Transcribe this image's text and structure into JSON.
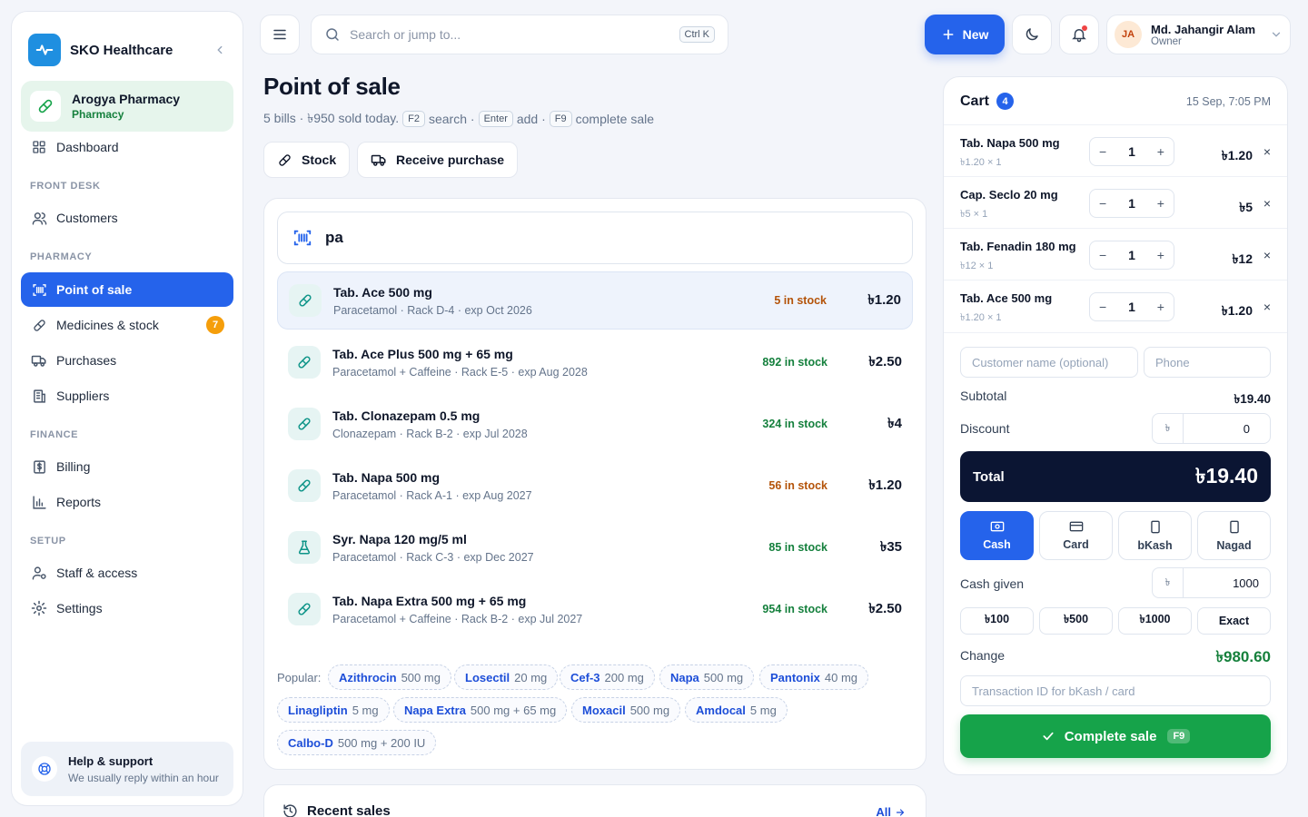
{
  "brand": {
    "name": "SKO Healthcare"
  },
  "org": {
    "name": "Arogya Pharmacy",
    "type": "Pharmacy"
  },
  "nav": {
    "dashboard": "Dashboard",
    "front_desk": "FRONT DESK",
    "customers": "Customers",
    "pharmacy": "PHARMACY",
    "pos": "Point of sale",
    "medicines": "Medicines & stock",
    "medicines_badge": "7",
    "purchases": "Purchases",
    "suppliers": "Suppliers",
    "finance": "FINANCE",
    "billing": "Billing",
    "reports": "Reports",
    "setup": "SETUP",
    "staff": "Staff & access",
    "settings": "Settings"
  },
  "help": {
    "title": "Help & support",
    "subtitle": "We usually reply within an hour"
  },
  "topbar": {
    "search_placeholder": "Search or jump to...",
    "search_shortcut": "Ctrl K",
    "new_label": "New",
    "user_initials": "JA",
    "user_name": "Md. Jahangir Alam",
    "user_role": "Owner"
  },
  "page": {
    "title": "Point of sale",
    "summary": "5 bills · ৳950 sold today.",
    "kbd_search": "F2",
    "search_word": "search ·",
    "kbd_add": "Enter",
    "add_word": "add ·",
    "kbd_complete": "F9",
    "complete_word": "complete sale",
    "stock_btn": "Stock",
    "receive_btn": "Receive purchase"
  },
  "product_search": {
    "value": "pa"
  },
  "products": [
    {
      "name": "Tab. Ace 500 mg",
      "details": "Paracetamol · Rack D-4 · exp Oct 2026",
      "stock": "5 in stock",
      "price": "৳1.20"
    },
    {
      "name": "Tab. Ace Plus 500 mg + 65 mg",
      "details": "Paracetamol + Caffeine · Rack E-5 · exp Aug 2028",
      "stock": "892 in stock",
      "price": "৳2.50"
    },
    {
      "name": "Tab. Clonazepam 0.5 mg",
      "details": "Clonazepam · Rack B-2 · exp Jul 2028",
      "stock": "324 in stock",
      "price": "৳4"
    },
    {
      "name": "Tab. Napa 500 mg",
      "details": "Paracetamol · Rack A-1 · exp Aug 2027",
      "stock": "56 in stock",
      "price": "৳1.20"
    },
    {
      "name": "Syr. Napa 120 mg/5 ml",
      "details": "Paracetamol · Rack C-3 · exp Dec 2027",
      "stock": "85 in stock",
      "price": "৳35"
    },
    {
      "name": "Tab. Napa Extra 500 mg + 65 mg",
      "details": "Paracetamol + Caffeine · Rack B-2 · exp Jul 2027",
      "stock": "954 in stock",
      "price": "৳2.50"
    }
  ],
  "popular": {
    "label": "Popular:",
    "items": [
      {
        "name": "Azithrocin",
        "dose": "500 mg"
      },
      {
        "name": "Losectil",
        "dose": "20 mg"
      },
      {
        "name": "Cef-3",
        "dose": "200 mg"
      },
      {
        "name": "Napa",
        "dose": "500 mg"
      },
      {
        "name": "Pantonix",
        "dose": "40 mg"
      },
      {
        "name": "Linagliptin",
        "dose": "5 mg"
      },
      {
        "name": "Napa Extra",
        "dose": "500 mg + 65 mg"
      },
      {
        "name": "Moxacil",
        "dose": "500 mg"
      },
      {
        "name": "Amdocal",
        "dose": "5 mg"
      },
      {
        "name": "Calbo-D",
        "dose": "500 mg + 200 IU"
      }
    ]
  },
  "recent_sales": {
    "title": "Recent sales",
    "link": "All"
  },
  "cart": {
    "title": "Cart",
    "count": "4",
    "datetime": "15 Sep, 7:05 PM",
    "items": [
      {
        "name": "Tab. Napa 500 mg",
        "unit": "৳1.20 × 1",
        "qty": "1",
        "total": "৳1.20"
      },
      {
        "name": "Cap. Seclo 20 mg",
        "unit": "৳5 × 1",
        "qty": "1",
        "total": "৳5"
      },
      {
        "name": "Tab. Fenadin 180 mg",
        "unit": "৳12 × 1",
        "qty": "1",
        "total": "৳12"
      },
      {
        "name": "Tab. Ace 500 mg",
        "unit": "৳1.20 × 1",
        "qty": "1",
        "total": "৳1.20"
      }
    ],
    "customer_placeholder": "Customer name (optional)",
    "phone_placeholder": "Phone",
    "subtotal_label": "Subtotal",
    "subtotal": "৳19.40",
    "discount_label": "Discount",
    "currency": "৳",
    "discount": "0",
    "total_label": "Total",
    "total": "৳19.40",
    "payment_methods": [
      "Cash",
      "Card",
      "bKash",
      "Nagad"
    ],
    "selected_method": "Cash",
    "cash_given_label": "Cash given",
    "cash_given": "1000",
    "quick_amounts": [
      "৳100",
      "৳500",
      "৳1000",
      "Exact"
    ],
    "change_label": "Change",
    "change": "৳980.60",
    "txn_placeholder": "Transaction ID for bKash / card",
    "complete_label": "Complete sale",
    "complete_kbd": "F9"
  },
  "colors": {
    "primary": "#2563eb",
    "success": "#16a34a",
    "warning": "#b45309",
    "total_bg": "#0b1533"
  }
}
